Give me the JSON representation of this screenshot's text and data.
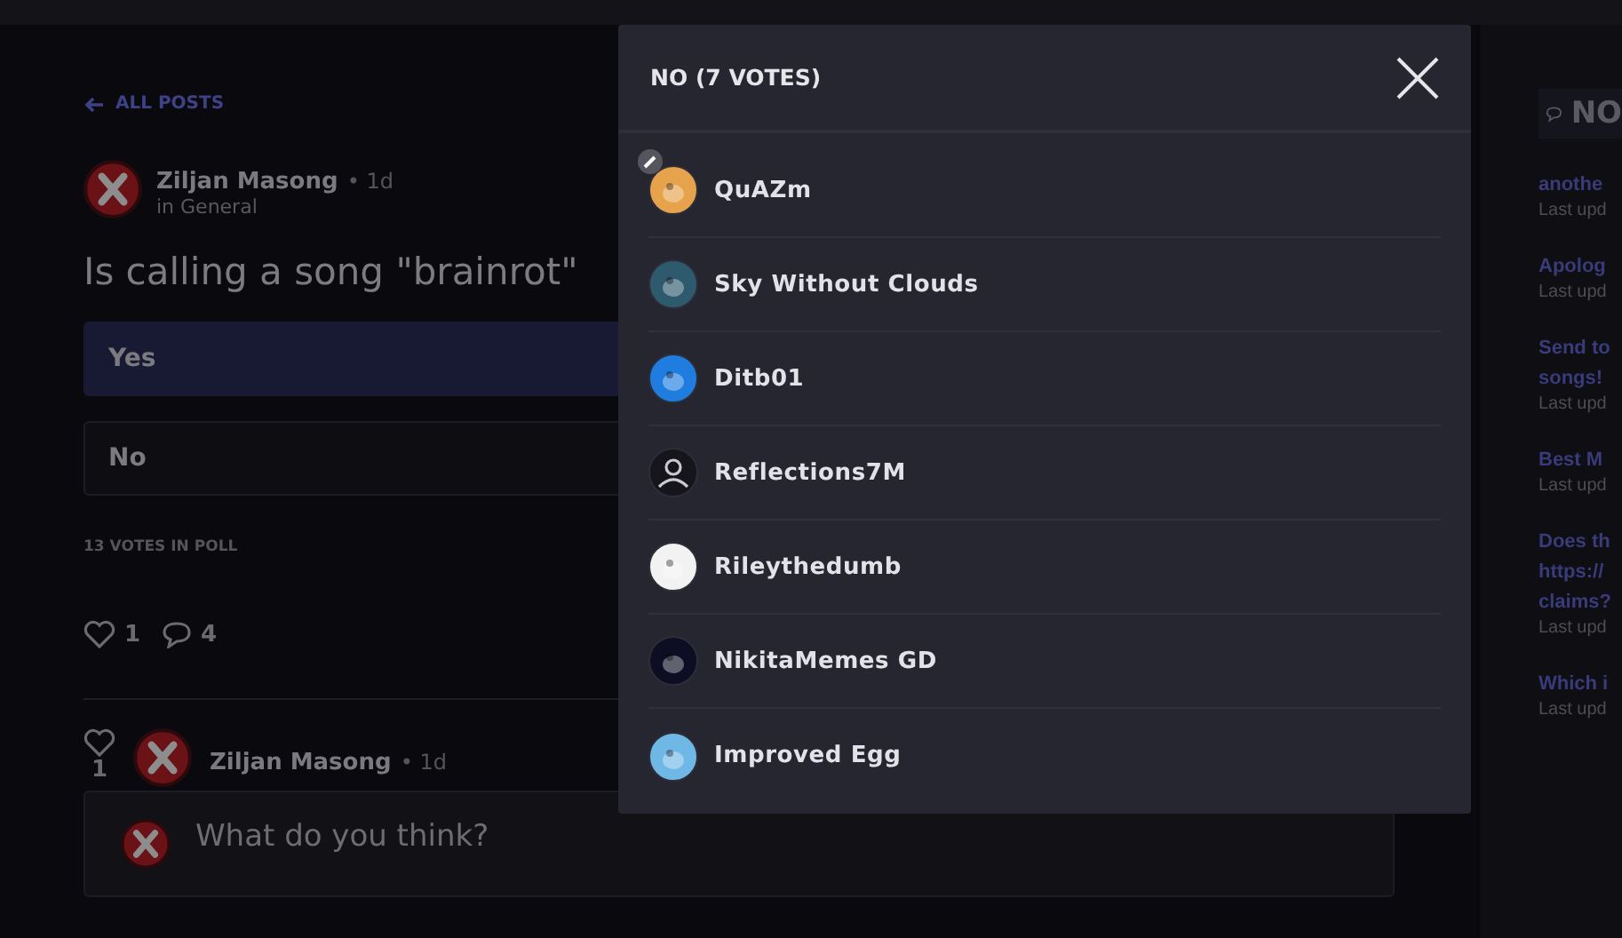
{
  "back_link": "ALL POSTS",
  "post": {
    "author": "Ziljan Masong",
    "separator": "•",
    "age": "1d",
    "category": "in General",
    "title": "Is calling a song \"brainrot\"",
    "options": [
      {
        "label": "Yes",
        "selected": true
      },
      {
        "label": "No",
        "selected": false
      }
    ],
    "votes_total": "13 VOTES IN POLL",
    "likes": "1",
    "comments": "4"
  },
  "comment": {
    "likes": "1",
    "author": "Ziljan Masong",
    "separator": "•",
    "age": "1d"
  },
  "reply_box": {
    "placeholder": "What do you think?"
  },
  "sidebar": {
    "heading": "NO",
    "items": [
      {
        "title_lines": [
          "anothe"
        ],
        "meta": "Last upd"
      },
      {
        "title_lines": [
          "Apolog"
        ],
        "meta": "Last upd"
      },
      {
        "title_lines": [
          "Send to",
          "songs!"
        ],
        "meta": "Last upd"
      },
      {
        "title_lines": [
          "Best M"
        ],
        "meta": "Last upd"
      },
      {
        "title_lines": [
          "Does th",
          "https://",
          "claims?"
        ],
        "meta": "Last upd"
      },
      {
        "title_lines": [
          "Which i"
        ],
        "meta": "Last upd"
      }
    ]
  },
  "modal": {
    "title": "NO (7 VOTES)",
    "voters": [
      {
        "name": "QuAZm",
        "color": "#e7a24c",
        "kind": "image",
        "edit_badge": true
      },
      {
        "name": "Sky Without Clouds",
        "color": "#2e5a6e",
        "kind": "image",
        "edit_badge": false
      },
      {
        "name": "Ditb01",
        "color": "#1f7de0",
        "kind": "image",
        "edit_badge": false
      },
      {
        "name": "Reflections7M",
        "color": "#15151b",
        "kind": "silhouette",
        "edit_badge": false
      },
      {
        "name": "Rileythedumb",
        "color": "#f2f2f2",
        "kind": "image",
        "edit_badge": false
      },
      {
        "name": "NikitaMemes GD",
        "color": "#0d0d24",
        "kind": "image",
        "edit_badge": false
      },
      {
        "name": "Improved Egg",
        "color": "#6fb8e6",
        "kind": "image",
        "edit_badge": false
      }
    ]
  }
}
